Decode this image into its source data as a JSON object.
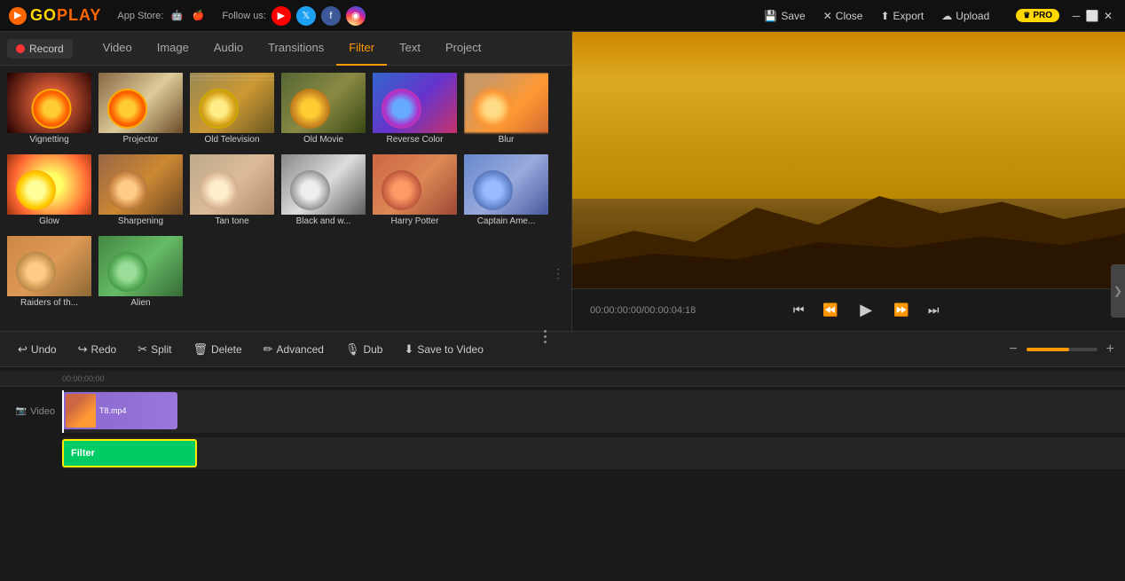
{
  "app": {
    "name": "GOPLAY",
    "logo_color": "#ff6600",
    "pro_label": "PRO"
  },
  "appstore": {
    "label": "App Store:"
  },
  "follow": {
    "label": "Follow us:"
  },
  "header_actions": {
    "save": "Save",
    "close": "Close",
    "export": "Export",
    "upload": "Upload"
  },
  "tabs": {
    "record": "Record",
    "video": "Video",
    "image": "Image",
    "audio": "Audio",
    "transitions": "Transitions",
    "filter": "Filter",
    "text": "Text",
    "project": "Project"
  },
  "filters": [
    {
      "id": "vignetting",
      "label": "Vignetting",
      "thumb_class": "thumb-vignetting"
    },
    {
      "id": "projector",
      "label": "Projector",
      "thumb_class": "thumb-projector"
    },
    {
      "id": "old-television",
      "label": "Old Television",
      "thumb_class": "thumb-old-tv"
    },
    {
      "id": "old-movie",
      "label": "Old Movie",
      "thumb_class": "thumb-old-movie"
    },
    {
      "id": "reverse-color",
      "label": "Reverse Color",
      "thumb_class": "thumb-reverse"
    },
    {
      "id": "blur",
      "label": "Blur",
      "thumb_class": "thumb-blur"
    },
    {
      "id": "glow",
      "label": "Glow",
      "thumb_class": "thumb-glow"
    },
    {
      "id": "sharpening",
      "label": "Sharpening",
      "thumb_class": "thumb-sharpening"
    },
    {
      "id": "tan-tone",
      "label": "Tan tone",
      "thumb_class": "thumb-tan"
    },
    {
      "id": "black-and-white",
      "label": "Black and w...",
      "thumb_class": "thumb-bw"
    },
    {
      "id": "harry-potter",
      "label": "Harry Potter",
      "thumb_class": "thumb-harry"
    },
    {
      "id": "captain-america",
      "label": "Captain Ame...",
      "thumb_class": "thumb-captain"
    },
    {
      "id": "raiders",
      "label": "Raiders of th...",
      "thumb_class": "thumb-raiders"
    },
    {
      "id": "alien",
      "label": "Alien",
      "thumb_class": "thumb-alien"
    }
  ],
  "bottom_toolbar": {
    "undo": "Undo",
    "redo": "Redo",
    "split": "Split",
    "delete": "Delete",
    "advanced": "Advanced",
    "dub": "Dub",
    "save_to_video": "Save to Video"
  },
  "timeline": {
    "video_label": "Video",
    "clip_name": "T8.mp4",
    "filter_label": "Filter",
    "ruler_marks": [
      "00:00:00:00",
      ""
    ],
    "time_display": "00:00:00:00/00:00:04:18"
  }
}
